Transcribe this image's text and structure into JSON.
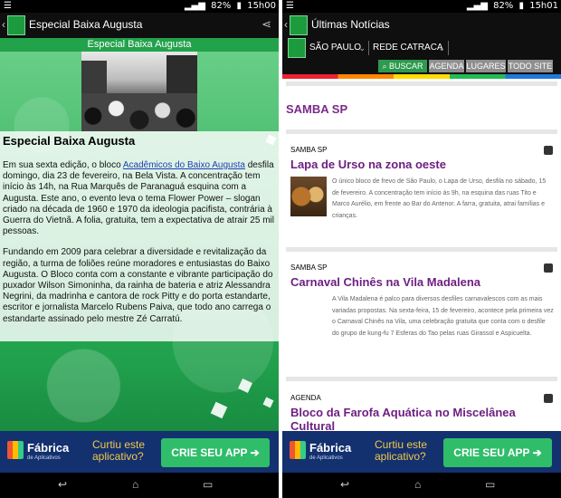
{
  "status_bar": {
    "battery": "82%",
    "left_screen_time": "15h00",
    "right_screen_time": "15h01"
  },
  "left_screen": {
    "app_title": "Especial Baixa Augusta",
    "section_band": "Especial Baixa Augusta",
    "article": {
      "title": "Especial Baixa Augusta",
      "p1_before_link": "Em sua sexta edição, o bloco ",
      "p1_link": "Acadêmicos do Baixo Augusta",
      "p1_after_link": " desfila domingo, dia 23 de fevereiro, na Bela Vista. A concentração tem início às 14h, na Rua Marquês de Paranaguá esquina com a Augusta. Este ano, o evento leva o tema Flower Power – slogan criado na década de 1960 e 1970 da ideologia pacifista, contrária à Guerra do Vietnã. A folia, gratuita, tem a expectativa de atrair 25 mil pessoas.",
      "p2": "Fundando em 2009 para celebrar a diversidade e revitalização da região, a turma de foliões reúne moradores e entusiastas do Baixo Augusta. O Bloco conta com a constante e vibrante participação do puxador Wilson Simoninha, da rainha de bateria e atriz Alessandra Negrini, da madrinha e cantora de rock Pitty e do porta estandarte, escritor e jornalista Marcelo Rubens Paiva, que todo ano carrega o estandarte assinado pelo mestre Zé Carratú."
    }
  },
  "right_screen": {
    "app_title": "Últimas Notícias",
    "filters": {
      "city": "SÃO PAULO",
      "network": "REDE CATRACA"
    },
    "toolbar": {
      "search": "BUSCAR",
      "agenda": "AGENDA",
      "places": "LUGARES",
      "whole_site": "TODO SITE"
    },
    "section_title": "SAMBA SP",
    "news": [
      {
        "category": "SAMBA SP",
        "headline": "Lapa de Urso na zona oeste",
        "body": "O único bloco de frevo de São Paulo, o Lapa de Urso, desfila no sábado, 15 de fevereiro. A concentração tem início às 9h, na esquina das ruas Tito e Marco Aurélio, em frente ao Bar do Antenor. A farra, gratuita, atrai famílias e crianças."
      },
      {
        "category": "SAMBA SP",
        "headline": "Carnaval Chinês na Vila Madalena",
        "body": "A Vila Madalena é palco para diversos desfiles carnavalescos com as mais variadas propostas. Na sexta-feira, 15 de fevereiro, acontece pela primeira vez o Carnaval Chinês na Vila, uma celebração gratuita que conta com o desfile do grupo de kung-fu 7 Esferas do Tao pelas ruas Girassol e Aspicuelta."
      },
      {
        "category": "AGENDA",
        "headline": "Bloco da Farofa Aquática no Miscelânea Cultural"
      }
    ]
  },
  "ad_banner": {
    "brand_name": "Fábrica",
    "brand_sub": "de Aplicativos",
    "question": "Curtiu este aplicativo?",
    "cta": "CRIE SEU APP ➔"
  },
  "icons": {
    "back": "back-icon",
    "home": "home-icon",
    "recents": "recents-icon",
    "share": "share-icon",
    "search": "search-icon",
    "calendar": "calendar-icon"
  },
  "colors": {
    "brand_green": "#23a24c",
    "headline_purple": "#6e1f82",
    "ad_blue": "#13306f",
    "cta_green": "#2fbd6a"
  }
}
